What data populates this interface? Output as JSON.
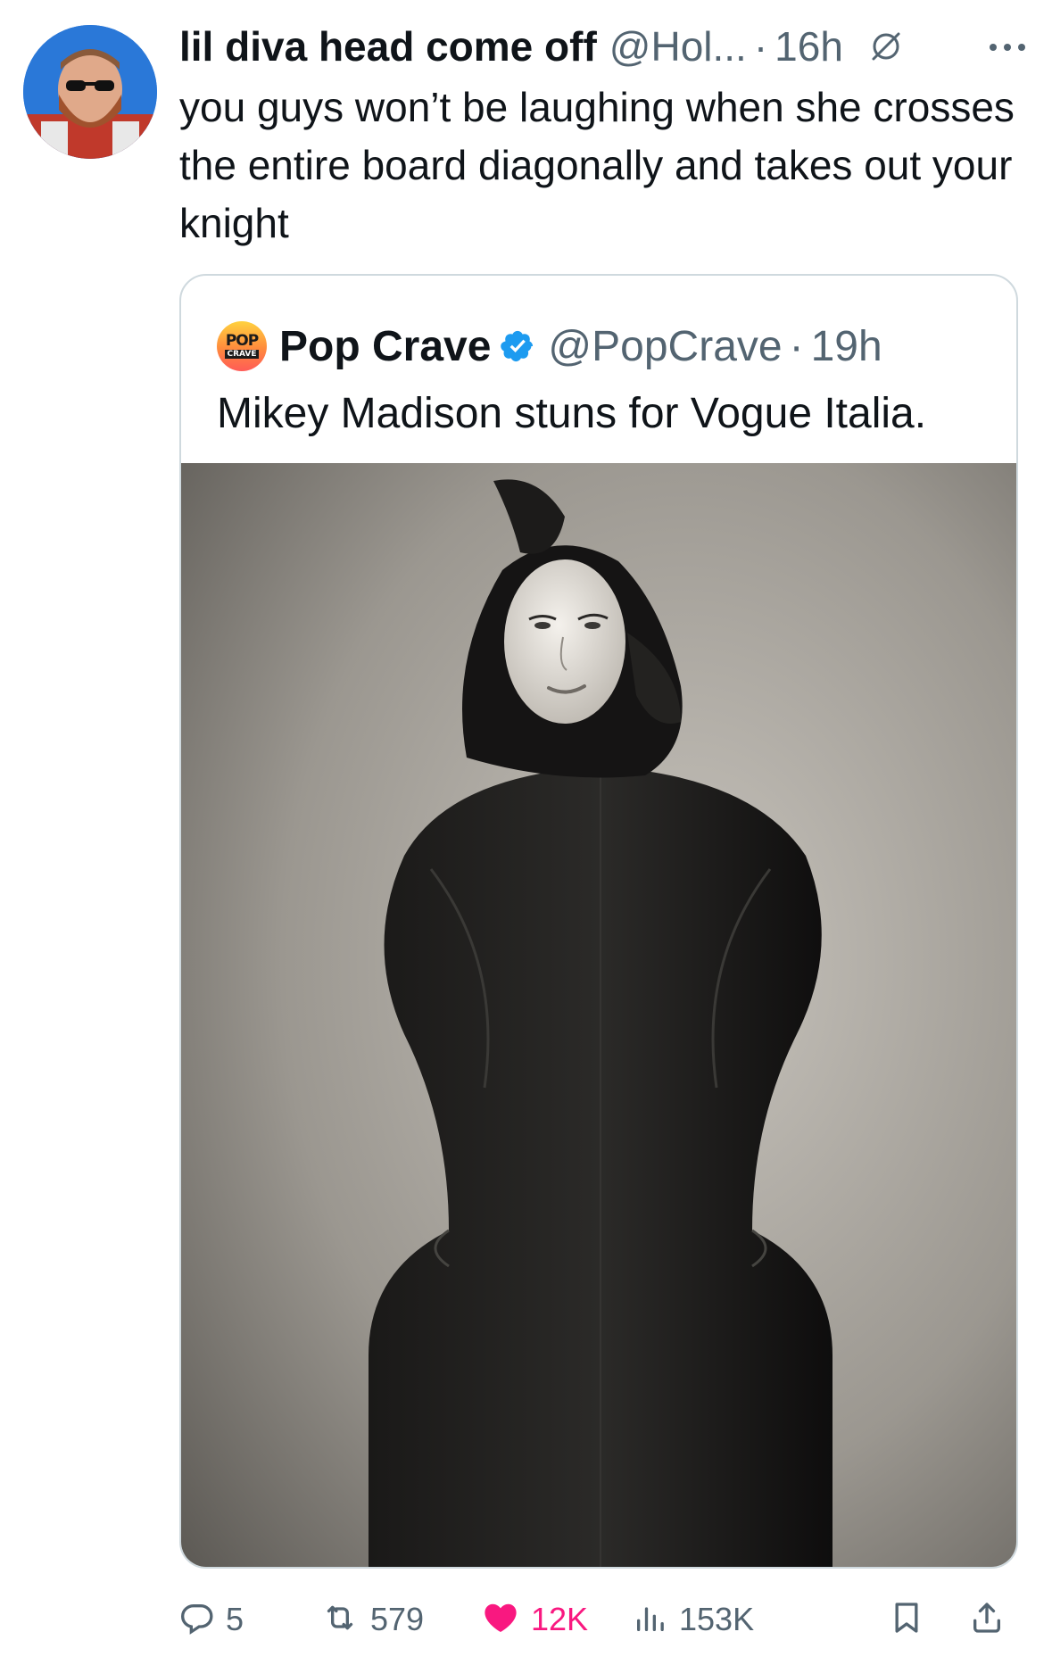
{
  "tweet": {
    "author_name": "lil diva head come off",
    "handle": "@Hol...",
    "separator": "·",
    "time": "16h",
    "text": "you guys won’t be laughing when she crosses the entire board diagonally and takes out your knight",
    "icons": {
      "hidden": "eye-slash-icon",
      "more": "more-icon"
    }
  },
  "quote": {
    "logo_top": "POP",
    "logo_bottom": "CRAVE",
    "author_name": "Pop Crave",
    "handle": "@PopCrave",
    "separator": "·",
    "time": "19h",
    "text": "Mikey Madison stuns for Vogue Italia.",
    "verified_icon": "verified-badge-icon"
  },
  "actions": {
    "replies": "5",
    "reposts": "579",
    "likes": "12K",
    "views": "153K",
    "icons": [
      "reply-icon",
      "repost-icon",
      "like-icon",
      "views-icon",
      "bookmark-icon",
      "share-icon"
    ]
  },
  "colors": {
    "text": "#0f1419",
    "secondary": "#536471",
    "border": "#cfd9de",
    "like": "#f91880",
    "verified": "#1d9bf0"
  }
}
